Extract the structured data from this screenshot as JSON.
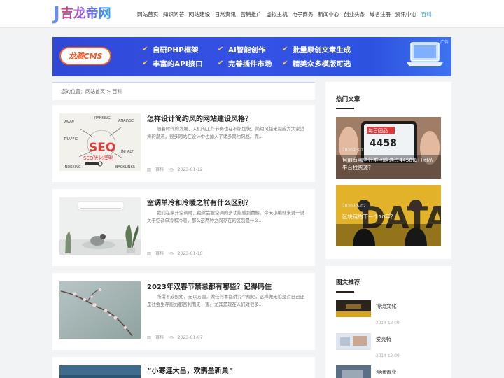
{
  "header": {
    "logo_mark": "J",
    "logo_text": "吉龙帝网",
    "nav": [
      "网站首页",
      "知识问答",
      "网站建设",
      "日常资讯",
      "营销推广",
      "虚拟主机",
      "电子商务",
      "新闻中心",
      "创业头条",
      "域名注册",
      "资讯中心",
      "百科"
    ],
    "active_nav": "百科"
  },
  "banner": {
    "brand": "龙腾CMS",
    "ad_label": "广告",
    "features": [
      "自研PHP框架",
      "AI智能创作",
      "批量原创文章生成",
      "丰富的API接口",
      "完善插件市场",
      "精美众多模版可选"
    ],
    "colors": {
      "bg": "#3552e6",
      "brand": "#f05a28",
      "check": "#ffd84a"
    }
  },
  "breadcrumb": {
    "text": "您的位置：网站首页 > 百科"
  },
  "articles": [
    {
      "title": "怎样设计简约风的网站建设风格？",
      "desc": "随着时代的发展，人们的工作节奏也在不断加快，简约风越来越成为大家追捧的潮流，很多网站在设计中也加入了诸多简约风格。而...",
      "category": "百科",
      "date": "2023-01-12",
      "thumb": {
        "big": "SEO",
        "sub": "SEO优化模型",
        "words": [
          "WWW",
          "RANKING",
          "ANALYSE",
          "TRAFFIC",
          "INDEXING",
          "BACKLINKS",
          "INHALT"
        ]
      }
    },
    {
      "title": "空调单冷和冷暖之前有什么区别？",
      "desc": "我们在家开空调时，经常会被空调的多功能感到费解。今天小编就来说一说关于空调单冷和冷暖，那么这两种之间存在的区别是什么...",
      "category": "百科",
      "date": "2023-01-10"
    },
    {
      "title": "2023年双春节禁忌都有哪些？记得码住",
      "desc": "所谓不成规矩，无以方圆。做任何事都讲究个规矩，这样做无论是对自己还是社会生存能力都百利而无一害。尤其是现在人们对很多...",
      "category": "百科",
      "date": "2023-01-07"
    },
    {
      "title": "“小寒连大吕，欢鹊垒新巢”"
    }
  ],
  "sidebar": {
    "hot_heading": "热门文章",
    "hot": [
      {
        "date": "2020-03-12",
        "title": "目前有哪些社群团购通过4458每日团品平台找货源？",
        "overlay": "每日团品",
        "number": "4458"
      },
      {
        "date": "2020-05-02",
        "title": "区块链的下一个10年？",
        "overlay": "DATA"
      }
    ],
    "rec_heading": "图文推荐",
    "rec": [
      {
        "title": "博涛文化",
        "date": "2014-12-09"
      },
      {
        "title": "爱亮特",
        "date": "2014-12-09"
      },
      {
        "title": "澳洲置业"
      }
    ]
  }
}
